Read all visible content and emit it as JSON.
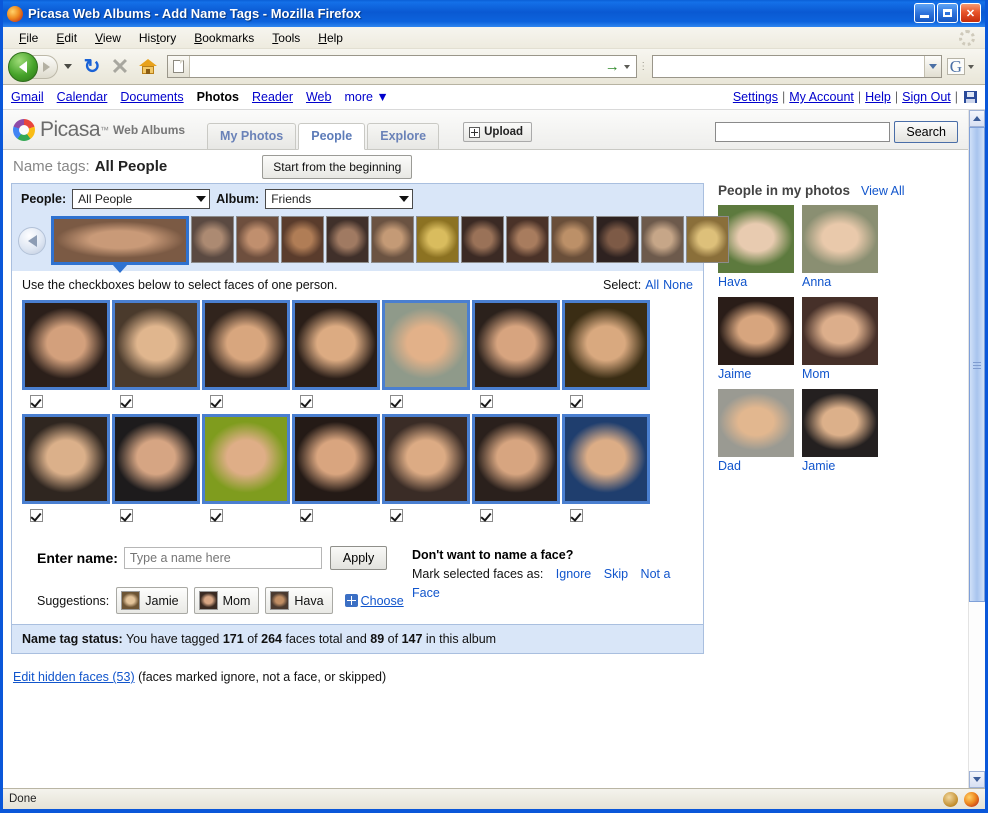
{
  "window": {
    "title": "Picasa Web Albums - Add Name Tags - Mozilla Firefox",
    "minimize_label": "Minimize",
    "maximize_label": "Maximize",
    "close_label": "Close"
  },
  "menubar": {
    "items": [
      "File",
      "Edit",
      "View",
      "History",
      "Bookmarks",
      "Tools",
      "Help"
    ]
  },
  "toolbar": {
    "back_label": "Back",
    "forward_label": "Forward",
    "reload_label": "Reload",
    "stop_label": "Stop",
    "home_label": "Home",
    "url_value": "",
    "url_placeholder": "",
    "go_label": "Go",
    "search_value": "",
    "search_placeholder": "",
    "search_engine": "G"
  },
  "gbar": {
    "links": [
      "Gmail",
      "Calendar",
      "Documents",
      "Photos",
      "Reader",
      "Web"
    ],
    "current": "Photos",
    "more_label": "more",
    "right_links": [
      "Settings",
      "My Account",
      "Help",
      "Sign Out"
    ],
    "separator": "|"
  },
  "picasa": {
    "brand": "Picasa",
    "trademark": "™",
    "brand_sub": "Web Albums",
    "tabs": [
      {
        "label": "My Photos",
        "active": false
      },
      {
        "label": "People",
        "active": true
      },
      {
        "label": "Explore",
        "active": false
      }
    ],
    "upload_label": "Upload",
    "search_value": "",
    "search_placeholder": "",
    "search_button": "Search"
  },
  "page_header": {
    "label": "Name tags:",
    "value": "All People",
    "start_button": "Start from the beginning"
  },
  "filters": {
    "people_label": "People:",
    "people_value": "All People",
    "album_label": "Album:",
    "album_value": "Friends"
  },
  "filmstrip": {
    "prev_label": "Previous",
    "next_label": "Next",
    "thumbs": [
      {
        "selected": true,
        "c1": "#7b5a44",
        "c2": "#c99a78"
      },
      {
        "selected": false,
        "c1": "#5b4a42",
        "c2": "#ac8a72"
      },
      {
        "selected": false,
        "c1": "#6e4f3e",
        "c2": "#c08f6e"
      },
      {
        "selected": false,
        "c1": "#5a3c2c",
        "c2": "#b07d56"
      },
      {
        "selected": false,
        "c1": "#40302a",
        "c2": "#a07a62"
      },
      {
        "selected": false,
        "c1": "#6b5342",
        "c2": "#c49a76"
      },
      {
        "selected": false,
        "c1": "#8c7222",
        "c2": "#d9bc5e"
      },
      {
        "selected": false,
        "c1": "#3b2a24",
        "c2": "#9a7258"
      },
      {
        "selected": false,
        "c1": "#4a3228",
        "c2": "#a87c5e"
      },
      {
        "selected": false,
        "c1": "#6a4f3a",
        "c2": "#bc9068"
      },
      {
        "selected": false,
        "c1": "#2e2220",
        "c2": "#7d5a46"
      },
      {
        "selected": false,
        "c1": "#6d5a4c",
        "c2": "#c6a688"
      },
      {
        "selected": false,
        "c1": "#8a6f3a",
        "c2": "#ddc07a"
      }
    ]
  },
  "instructions": {
    "text": "Use the checkboxes below to select faces of one person.",
    "select_label": "Select:",
    "select_all": "All",
    "select_none": "None"
  },
  "faces": {
    "rows": [
      [
        {
          "checked": true,
          "c1": "#2b1f1a",
          "c2": "#d3a07c"
        },
        {
          "checked": true,
          "c1": "#4a3a2c",
          "c2": "#e0b68e"
        },
        {
          "checked": true,
          "c1": "#31241d",
          "c2": "#d8a67e"
        },
        {
          "checked": true,
          "c1": "#2a1e18",
          "c2": "#dcab82"
        },
        {
          "checked": true,
          "c1": "#8f9a8a",
          "c2": "#e2b189"
        },
        {
          "checked": true,
          "c1": "#2b211c",
          "c2": "#d7a47f"
        },
        {
          "checked": true,
          "c1": "#3a2d14",
          "c2": "#d9a97f"
        }
      ],
      [
        {
          "checked": true,
          "c1": "#2f2620",
          "c2": "#dbb08a"
        },
        {
          "checked": true,
          "c1": "#1d1b1c",
          "c2": "#d6a583"
        },
        {
          "checked": true,
          "c1": "#7f9c1e",
          "c2": "#dfae87"
        },
        {
          "checked": true,
          "c1": "#241a16",
          "c2": "#d9a57f"
        },
        {
          "checked": true,
          "c1": "#3a2c26",
          "c2": "#dcab84"
        },
        {
          "checked": true,
          "c1": "#2a201c",
          "c2": "#d7a580"
        },
        {
          "checked": true,
          "c1": "#1f3e6e",
          "c2": "#dcad86"
        }
      ]
    ]
  },
  "name_form": {
    "label": "Enter name:",
    "input_value": "",
    "input_placeholder": "Type a name here",
    "apply_label": "Apply",
    "suggestions_label": "Suggestions:",
    "suggestions": [
      {
        "name": "Jamie",
        "c1": "#6d5434",
        "c2": "#e3c39a"
      },
      {
        "name": "Mom",
        "c1": "#3a2a22",
        "c2": "#d8a684"
      },
      {
        "name": "Hava",
        "c1": "#4a3a30",
        "c2": "#c08e64"
      }
    ],
    "choose_label": "Choose",
    "dont_title": "Don't want to name a face?",
    "mark_label": "Mark selected faces as:",
    "mark_actions": [
      "Ignore",
      "Skip",
      "Not a Face"
    ]
  },
  "status_strip": {
    "label": "Name tag status:",
    "text_1": "You have tagged",
    "tagged": "171",
    "text_2": "of",
    "total": "264",
    "text_3": "faces total and",
    "album_tagged": "89",
    "text_4": "of",
    "album_total": "147",
    "text_5": "in this album"
  },
  "bottom": {
    "link": "Edit hidden faces (53)",
    "note": "(faces marked ignore, not a face, or skipped)"
  },
  "sidebar": {
    "title": "People in my photos",
    "view_all": "View All",
    "people": [
      {
        "name": "Hava",
        "c1": "#5d7a3e",
        "c2": "#e8cbb0"
      },
      {
        "name": "Anna",
        "c1": "#8a8f72",
        "c2": "#e9c9ab"
      },
      {
        "name": "Jaime",
        "c1": "#2a1d18",
        "c2": "#d7a57e"
      },
      {
        "name": "Mom",
        "c1": "#463029",
        "c2": "#dcae8b"
      },
      {
        "name": "Dad",
        "c1": "#9a9a92",
        "c2": "#e2b78f"
      },
      {
        "name": "Jamie",
        "c1": "#242020",
        "c2": "#dcb08a"
      }
    ]
  },
  "browser_status": {
    "text": "Done"
  }
}
